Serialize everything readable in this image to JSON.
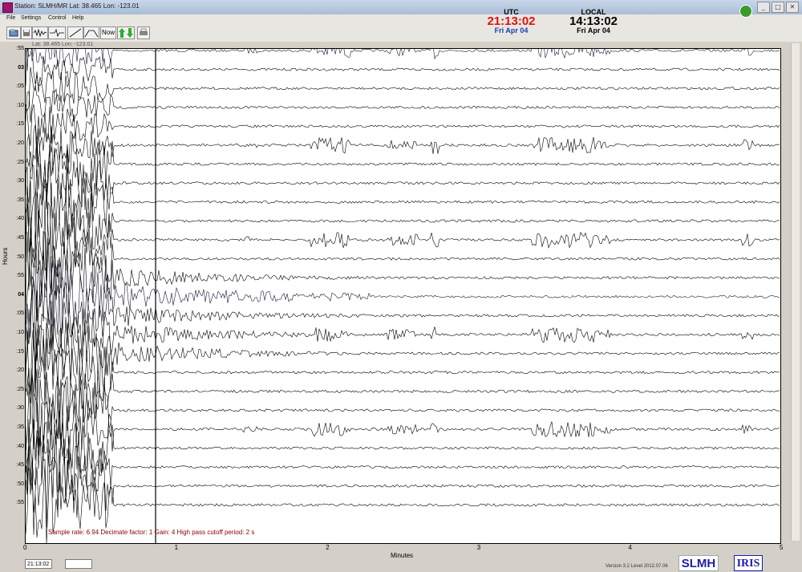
{
  "window": {
    "title": "Station: SLMH/MR Lat: 38.465 Lon: -123.01",
    "buttons": [
      "_",
      "□",
      "✕"
    ]
  },
  "menu": [
    "File",
    "Settings",
    "Control",
    "Help"
  ],
  "toolbar": {
    "now_label": "Now",
    "icons": [
      "open-file-icon",
      "save-file-icon",
      "waveform-icon",
      "filter-icon",
      "highpass-icon",
      "bandpass-icon",
      "zoom-arrows-icon",
      "print-icon"
    ]
  },
  "clock": {
    "utc_label": "UTC",
    "utc_time": "21:13:02",
    "utc_date": "Fri Apr 04",
    "local_label": "LOCAL",
    "local_time": "14:13:02",
    "local_date": "Fri Apr 04",
    "utc_color": "#e01010",
    "local_color": "#000000",
    "date_color": "#1a3fb0"
  },
  "plot": {
    "location": "Lat: 38.465 Lon: -123.01",
    "row_labels": [
      ":55",
      "03",
      ":05",
      ":10",
      ":15",
      ":20",
      ":25",
      ":30",
      ":35",
      ":40",
      ":45",
      ":50",
      ":55",
      "04",
      ":05",
      ":10",
      ":15",
      ":20",
      ":25",
      ":30",
      ":35",
      ":40",
      ":45",
      ":50",
      ":55"
    ],
    "hour_rows": [
      1,
      13
    ],
    "y_axis_title": "Hours",
    "x_axis_title": "Minutes",
    "x_ticks": [
      "0",
      "1",
      "2",
      "3",
      "4",
      "5"
    ],
    "sample_info": "Sample rate: 6.94  Decimate factor: 1  Gain: 4  High pass cutoff period: 2 s"
  },
  "status": {
    "time_value": "21:13:02",
    "second_value": "",
    "version": "Version 3.2 Level 2012.07.06",
    "station_logo": "SLMH",
    "org_logo": "IRIS"
  }
}
